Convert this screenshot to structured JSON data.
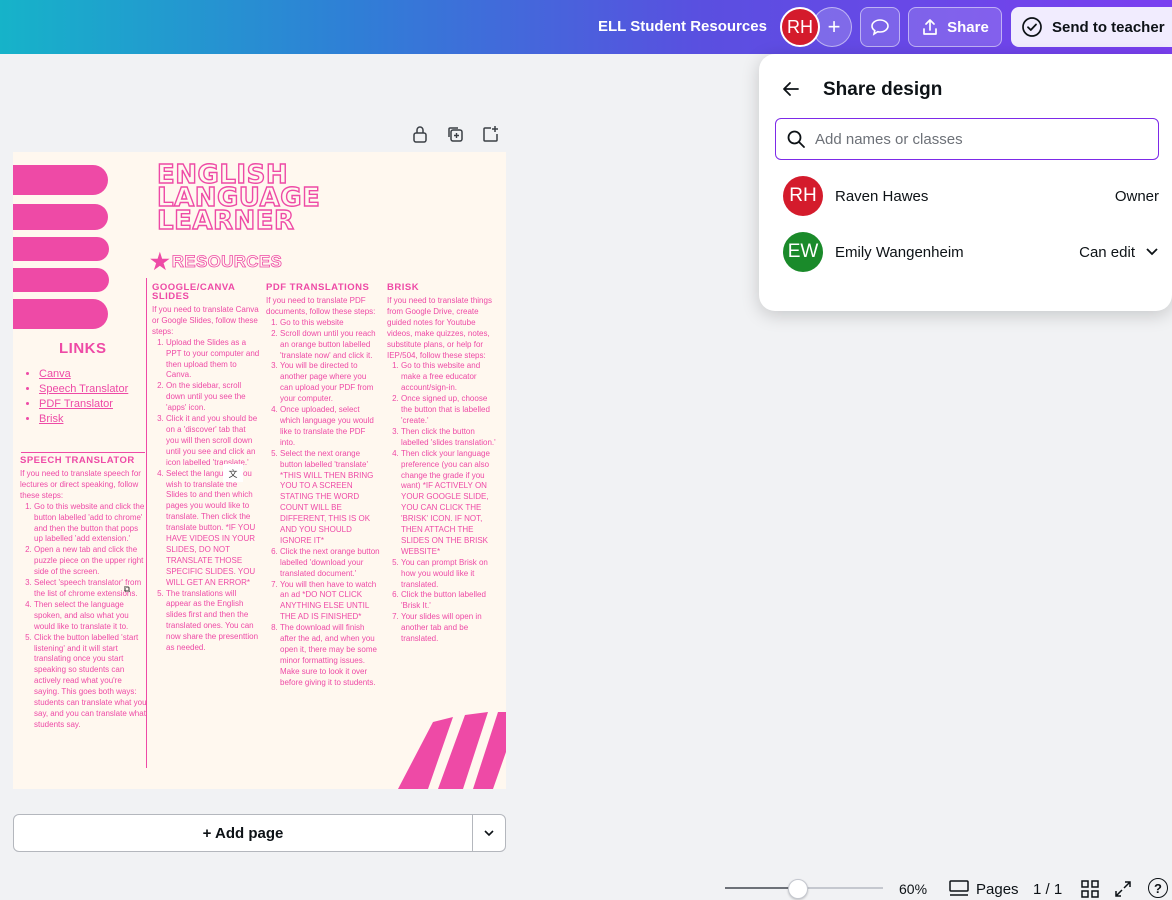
{
  "topbar": {
    "doc_title": "ELL Student Resources",
    "avatar_initials": "RH",
    "add_symbol": "+",
    "share_label": "Share",
    "send_label": "Send to teacher",
    "accent": "#d41b2c"
  },
  "design": {
    "title_lines": [
      "ENGLISH",
      "LANGUAGE",
      "LEARNER"
    ],
    "resources_label": "RESOURCES",
    "links_title": "LINKS",
    "links": [
      "Canva",
      "Speech Translator",
      "PDF Translator",
      "Brisk"
    ],
    "accent": "#ee4aa6",
    "speech": {
      "heading": "SPEECH TRANSLATOR",
      "intro": "If you need to translate speech for lectures or direct speaking, follow these steps:",
      "steps": [
        "Go to this website and click the button labelled 'add to chrome' and then the button that pops up labelled 'add extension.'",
        "Open a new tab and click the puzzle piece on the upper right side of the screen.",
        "Select 'speech translator' from the list of chrome extensions.",
        "Then select the language spoken, and also what you would like to translate it to.",
        "Click the button labelled 'start listening' and it will start translating once you start speaking so students can actively read what you're saying. This goes both ways: students can translate what you say, and you can translate what students say."
      ]
    },
    "google": {
      "heading": "GOOGLE/CANVA SLIDES",
      "intro": "If you need to translate Canva or Google Slides, follow these steps:",
      "steps": [
        "Upload the Slides as a PPT to your computer and then upload them to Canva.",
        "On the sidebar, scroll down until you see the 'apps' icon.",
        "Click it and you should be on a 'discover' tab that you will then scroll down until you see and click an icon labelled 'translate.'",
        "Select the language you wish to translate the Slides to and then which pages you would like to translate. Then click the translate button. *IF YOU HAVE VIDEOS IN YOUR SLIDES, DO NOT TRANSLATE THOSE SPECIFIC SLIDES. YOU WILL GET AN ERROR*",
        "The translations will appear as the English slides first and then the translated ones. You can now share the presenttion as needed."
      ]
    },
    "pdf": {
      "heading": "PDF TRANSLATIONS",
      "intro": "If you need to translate PDF documents, follow these steps:",
      "steps": [
        "Go to this website",
        "Scroll down until you reach an orange button labelled 'translate now' and click it.",
        "You will be directed to another page where you can upload your PDF from your computer.",
        "Once uploaded, select which language you would like to translate the PDF into.",
        "Select the next orange button labelled 'translate' *THIS WILL THEN BRING YOU TO A SCREEN STATING THE WORD COUNT WILL BE DIFFERENT, THIS IS OK AND YOU SHOULD IGNORE IT*",
        "Click the next orange button labelled 'download your translated document.'",
        "You will then have to watch an ad *DO NOT CLICK ANYTHING ELSE UNTIL THE AD IS FINISHED*",
        "The download will finish after the ad, and when you open it, there may be some minor formatting issues. Make sure to look it over before giving it to students."
      ]
    },
    "brisk": {
      "heading": "BRISK",
      "intro": "If you need to translate things from Google Drive, create guided notes for Youtube videos, make quizzes, notes, substitute plans, or help for IEP/504, follow these steps:",
      "steps": [
        "Go to this website and make a free educator account/sign-in.",
        "Once signed up, choose the button that is labelled 'create.'",
        "Then click the button labelled 'slides translation.'",
        "Then click your language preference (you can also change the grade if you want) *IF ACTIVELY ON YOUR GOOGLE SLIDE, YOU CAN CLICK THE 'BRISK' ICON. IF NOT, THEN ATTACH THE SLIDES ON THE BRISK WEBSITE*",
        "You can prompt Brisk on how you would like it translated.",
        "Click the button labelled 'Brisk It.'",
        "Your slides will open in another tab and be translated."
      ]
    }
  },
  "canvas": {
    "add_page_label": "+ Add page"
  },
  "footer": {
    "zoom_fraction": 0.45,
    "zoom_label": "60%",
    "pages_label": "Pages",
    "page_count": "1 / 1",
    "help_symbol": "?"
  },
  "share_panel": {
    "title": "Share design",
    "search_placeholder": "Add names or classes",
    "members": [
      {
        "initials": "RH",
        "name": "Raven Hawes",
        "role": "Owner",
        "color": "#d41b2c"
      },
      {
        "initials": "EW",
        "name": "Emily Wangenheim",
        "role": "Can edit",
        "color": "#1a8a2a"
      }
    ]
  }
}
